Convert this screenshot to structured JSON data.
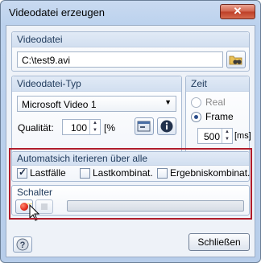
{
  "window": {
    "title": "Videodatei erzeugen"
  },
  "videodatei": {
    "group_title": "Videodatei",
    "path_value": "C:\\test9.avi"
  },
  "videotyp": {
    "group_title": "Videodatei-Typ",
    "codec_selected": "Microsoft Video 1",
    "quality_label": "Qualität:",
    "quality_value": "100",
    "quality_unit": "[%"
  },
  "zeit": {
    "group_title": "Zeit",
    "real_label": "Real",
    "frame_label": "Frame",
    "selected": "Frame",
    "ms_value": "500",
    "ms_unit": "[ms]"
  },
  "auto": {
    "group_title": "Automatsich iterieren über alle",
    "options": [
      {
        "label": "Lastfälle",
        "checked": true
      },
      {
        "label": "Lastkombinat.",
        "checked": false
      },
      {
        "label": "Ergebniskombinat.",
        "checked": false
      }
    ]
  },
  "schalter": {
    "group_title": "Schalter",
    "progress": 0
  },
  "footer": {
    "close_label": "Schließen"
  },
  "colors": {
    "highlight": "#b01c2b",
    "record": "#e32b1e"
  }
}
